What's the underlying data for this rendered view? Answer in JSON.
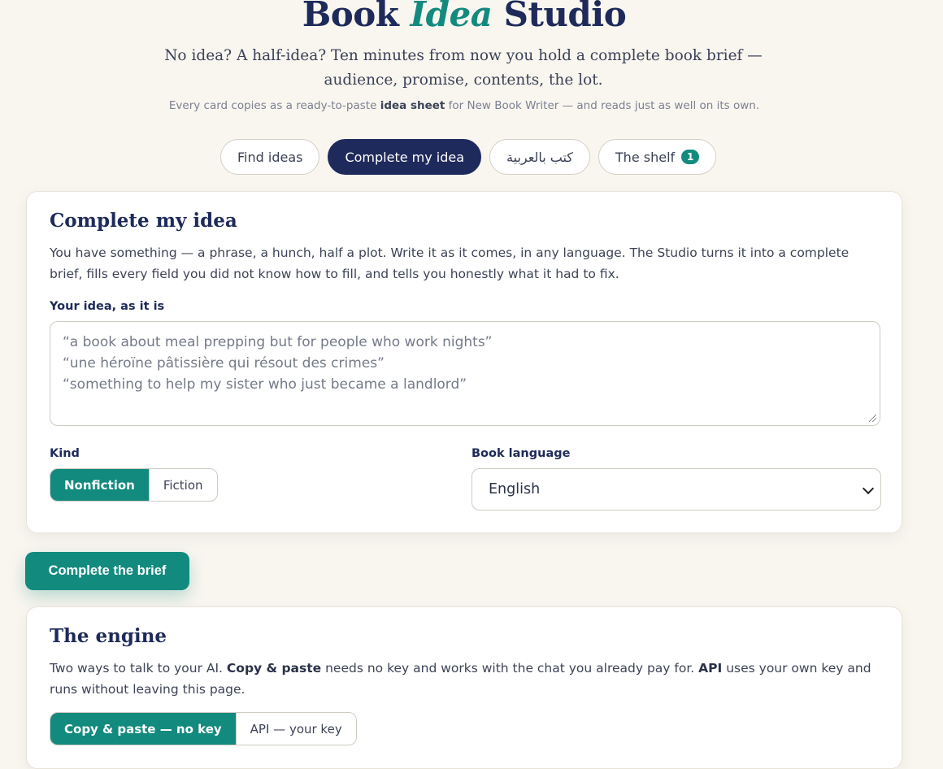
{
  "header": {
    "title_part1": "Book ",
    "title_part2": "Idea",
    "title_part3": " Studio",
    "tagline": "No idea? A half-idea? Ten minutes from now you hold a complete book brief — audience, promise, contents, the lot.",
    "subnote_before": "Every card copies as a ready-to-paste ",
    "subnote_bold": "idea sheet",
    "subnote_after": " for New Book Writer — and reads just as well on its own."
  },
  "tabs": [
    {
      "label": "Find ideas",
      "active": false
    },
    {
      "label": "Complete my idea",
      "active": true
    },
    {
      "label": "كتب بالعربية",
      "active": false
    },
    {
      "label": "The shelf",
      "badge": "1",
      "active": false
    }
  ],
  "complete_card": {
    "title": "Complete my idea",
    "description": "You have something — a phrase, a hunch, half a plot. Write it as it comes, in any language. The Studio turns it into a complete brief, fills every field you did not know how to fill, and tells you honestly what it had to fix.",
    "idea_label": "Your idea, as it is",
    "idea_placeholder": "“a book about meal prepping but for people who work nights”\n“une héroïne pâtissière qui résout des crimes”\n“something to help my sister who just became a landlord”",
    "kind_label": "Kind",
    "kind_options": [
      "Nonfiction",
      "Fiction"
    ],
    "kind_selected": "Nonfiction",
    "language_label": "Book language",
    "language_value": "English"
  },
  "cta_label": "Complete the brief",
  "engine_card": {
    "title": "The engine",
    "desc_1": "Two ways to talk to your AI. ",
    "desc_bold_1": "Copy & paste",
    "desc_2": " needs no key and works with the chat you already pay for. ",
    "desc_bold_2": "API",
    "desc_3": " uses your own key and runs without leaving this page.",
    "modes": [
      "Copy & paste — no key",
      "API — your key"
    ],
    "mode_selected": "Copy & paste — no key"
  },
  "colors": {
    "background": "#f9f6ef",
    "navy": "#1e2a5a",
    "teal": "#138a7e"
  }
}
